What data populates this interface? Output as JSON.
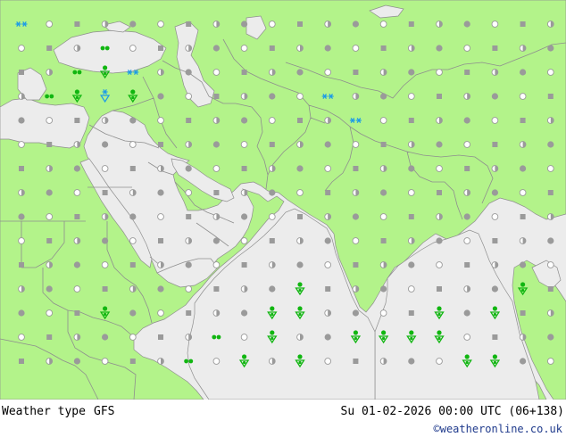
{
  "footer": {
    "label": "Weather type",
    "model": "GFS",
    "valid_time": "Su 01-02-2026 00:00 UTC (06+138)",
    "credit": "©weatheronline.co.uk"
  },
  "map": {
    "colors": {
      "land": "#b3f38a",
      "sea": "#ececec",
      "border": "#8e8e8e",
      "coast": "#8e8e8e",
      "dot": "#9a9a9a",
      "rain": "#11b611",
      "snow": "#1b9ae8"
    },
    "grid": {
      "cols": 20,
      "rows": 15
    },
    "special_symbols": [
      {
        "col": 0,
        "row": 0,
        "type": "snow-pair"
      },
      {
        "col": 3,
        "row": 1,
        "type": "rain-pair"
      },
      {
        "col": 2,
        "row": 2,
        "type": "rain-pair"
      },
      {
        "col": 3,
        "row": 2,
        "type": "rain-shower"
      },
      {
        "col": 4,
        "row": 2,
        "type": "snow-pair"
      },
      {
        "col": 1,
        "row": 3,
        "type": "rain-pair"
      },
      {
        "col": 2,
        "row": 3,
        "type": "rain-shower"
      },
      {
        "col": 3,
        "row": 3,
        "type": "snow-shower"
      },
      {
        "col": 4,
        "row": 3,
        "type": "rain-shower"
      },
      {
        "col": 11,
        "row": 3,
        "type": "snow-pair"
      },
      {
        "col": 12,
        "row": 4,
        "type": "snow-pair"
      },
      {
        "col": 10,
        "row": 11,
        "type": "rain-shower"
      },
      {
        "col": 18,
        "row": 11,
        "type": "rain-shower"
      },
      {
        "col": 3,
        "row": 12,
        "type": "rain-shower"
      },
      {
        "col": 9,
        "row": 12,
        "type": "rain-shower"
      },
      {
        "col": 10,
        "row": 12,
        "type": "rain-shower"
      },
      {
        "col": 15,
        "row": 12,
        "type": "rain-shower"
      },
      {
        "col": 17,
        "row": 12,
        "type": "rain-shower"
      },
      {
        "col": 7,
        "row": 13,
        "type": "rain-pair"
      },
      {
        "col": 9,
        "row": 13,
        "type": "rain-shower"
      },
      {
        "col": 12,
        "row": 13,
        "type": "rain-shower"
      },
      {
        "col": 13,
        "row": 13,
        "type": "rain-shower"
      },
      {
        "col": 14,
        "row": 13,
        "type": "rain-shower"
      },
      {
        "col": 15,
        "row": 13,
        "type": "rain-shower"
      },
      {
        "col": 6,
        "row": 14,
        "type": "rain-pair"
      },
      {
        "col": 8,
        "row": 14,
        "type": "rain-shower"
      },
      {
        "col": 10,
        "row": 14,
        "type": "rain-shower"
      },
      {
        "col": 16,
        "row": 14,
        "type": "rain-shower"
      },
      {
        "col": 17,
        "row": 14,
        "type": "rain-shower"
      }
    ]
  }
}
